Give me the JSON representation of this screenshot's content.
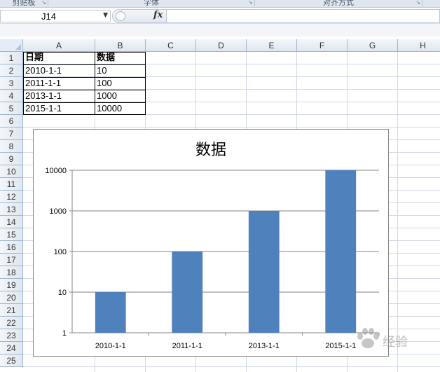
{
  "ribbon": {
    "groups": [
      {
        "label": "剪贴板"
      },
      {
        "label": "字体"
      },
      {
        "label": "对齐方式"
      }
    ]
  },
  "formula_bar": {
    "name_box": "J14",
    "fx_label": "fx",
    "formula": ""
  },
  "sheet": {
    "columns": [
      "A",
      "B",
      "C",
      "D",
      "E",
      "F",
      "G",
      "H"
    ],
    "rows": [
      "1",
      "2",
      "3",
      "4",
      "5",
      "6",
      "7",
      "8",
      "9",
      "10",
      "11",
      "12",
      "13",
      "14",
      "15",
      "16",
      "17",
      "18",
      "19",
      "20",
      "21",
      "22",
      "23",
      "24",
      "25"
    ],
    "table": {
      "headers": [
        "日期",
        "数据"
      ],
      "rows": [
        [
          "2010-1-1",
          "10"
        ],
        [
          "2011-1-1",
          "100"
        ],
        [
          "2013-1-1",
          "1000"
        ],
        [
          "2015-1-1",
          "10000"
        ]
      ]
    }
  },
  "chart_data": {
    "type": "bar",
    "title": "数据",
    "categories": [
      "2010-1-1",
      "2011-1-1",
      "2013-1-1",
      "2015-1-1"
    ],
    "values": [
      10,
      100,
      1000,
      10000
    ],
    "y_scale": "log",
    "ylim": [
      1,
      10000
    ],
    "y_ticks": [
      "1",
      "10",
      "100",
      "1000",
      "10000"
    ],
    "grid": true,
    "legend": "none",
    "bar_color": "#4f81bd"
  },
  "watermark": {
    "text": "经验"
  }
}
